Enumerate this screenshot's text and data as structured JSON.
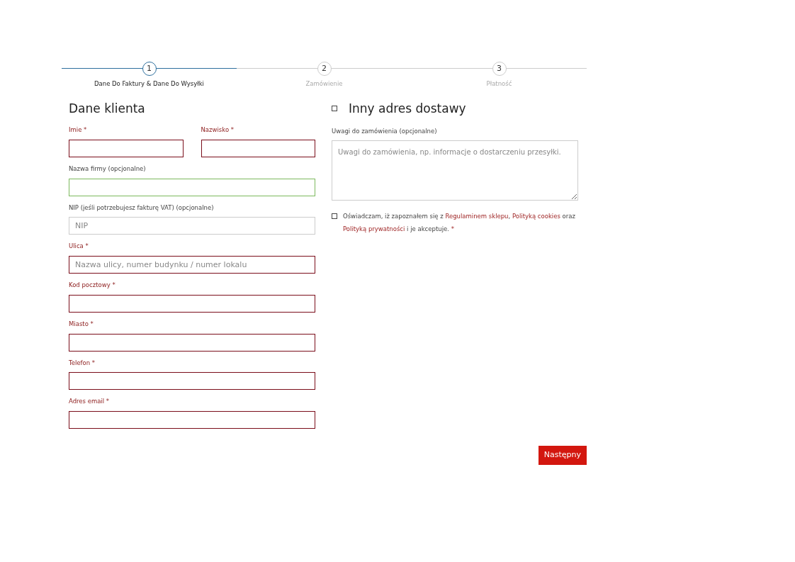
{
  "steps": [
    {
      "number": "1",
      "label": "Dane Do Faktury & Dane Do Wysyłki",
      "selected": true
    },
    {
      "number": "2",
      "label": "Zamówienie",
      "selected": false
    },
    {
      "number": "3",
      "label": "Płatność",
      "selected": false
    }
  ],
  "customer": {
    "title": "Dane klienta",
    "fields": [
      {
        "label": "Imie *",
        "error": true,
        "valid": false,
        "half": true
      },
      {
        "label": "Nazwisko *",
        "error": true,
        "valid": false,
        "half": true
      },
      {
        "label": "Nazwa firmy (opcjonalne)",
        "error": false,
        "valid": true,
        "half": false
      },
      {
        "label": "NIP (jeśli potrzebujesz fakturę VAT) (opcjonalne)",
        "error": false,
        "valid": false,
        "half": false,
        "placeholder": "NIP"
      },
      {
        "label": "Ulica *",
        "error": true,
        "valid": false,
        "half": false,
        "placeholder": "Nazwa ulicy, numer budynku / numer lokalu"
      },
      {
        "label": "Kod pocztowy *",
        "error": true,
        "valid": false,
        "half": false
      },
      {
        "label": "Miasto *",
        "error": true,
        "valid": false,
        "half": false
      },
      {
        "label": "Telefon *",
        "error": true,
        "valid": false,
        "half": false
      },
      {
        "label": "Adres email *",
        "error": true,
        "valid": false,
        "half": false
      }
    ]
  },
  "shipping": {
    "title": "Inny adres dostawy",
    "checked": false
  },
  "notes": {
    "label": "Uwagi do zamówienia (opcjonalne)",
    "placeholder": "Uwagi do zamówienia, np. informacje o dostarczeniu przesyłki."
  },
  "consent": {
    "checked": false,
    "parts": [
      {
        "kind": "text",
        "text": "Oświadczam, iż zapoznałem się z "
      },
      {
        "kind": "link",
        "text": "Regulaminem sklepu"
      },
      {
        "kind": "text",
        "text": ", "
      },
      {
        "kind": "link",
        "text": "Polityką cookies"
      },
      {
        "kind": "text",
        "text": " oraz "
      },
      {
        "kind": "link",
        "text": "Polityką prywatności"
      },
      {
        "kind": "text",
        "text": " i je akceptuje. "
      },
      {
        "kind": "required",
        "text": "*"
      }
    ]
  },
  "next_button": "Następny"
}
